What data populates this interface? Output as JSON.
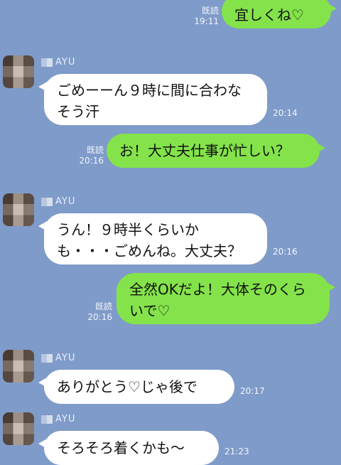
{
  "messages": [
    {
      "side": "out",
      "text": "宜しくね♡",
      "read": "既読",
      "time": "19:11"
    },
    {
      "side": "in",
      "name": "AYU",
      "text": "ごめーーん９時に間に合わなそう汗",
      "time": "20:14"
    },
    {
      "side": "out",
      "text": "お！大丈夫仕事が忙しい？",
      "read": "既読",
      "time": "20:16"
    },
    {
      "side": "in",
      "name": "AYU",
      "text": "うん！９時半くらいかも・・・ごめんね。大丈夫？",
      "time": "20:16"
    },
    {
      "side": "out",
      "text": "全然OKだよ！大体そのくらいで♡",
      "read": "既読",
      "time": "20:16"
    },
    {
      "side": "in",
      "name": "AYU",
      "text": "ありがとう♡じゃ後で",
      "time": "20:17"
    },
    {
      "side": "in",
      "name": "AYU",
      "text": "そろそろ着くかも〜",
      "time": "21:23"
    }
  ]
}
